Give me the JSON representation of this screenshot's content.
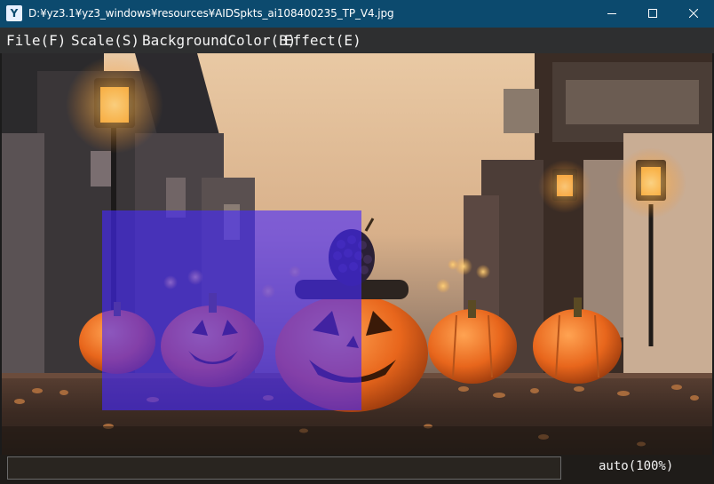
{
  "window": {
    "title": "D:¥yz3.1¥yz3_windows¥resources¥AIDSpkts_ai108400235_TP_V4.jpg",
    "app_icon_glyph": "ⓨ"
  },
  "menu": {
    "items": [
      {
        "label": "File(F)"
      },
      {
        "label": "Scale(S)"
      },
      {
        "label": "BackgroundColor(B)"
      },
      {
        "label": "Effect(E)"
      }
    ]
  },
  "status": {
    "zoom_text": "auto(100%)"
  },
  "colors": {
    "titlebar": "#0c4a6e",
    "menubar": "#2e2f30",
    "selection_overlay": "#4628ff"
  },
  "icons": {
    "minimize": "minimize-icon",
    "maximize": "maximize-icon",
    "close": "close-icon"
  }
}
